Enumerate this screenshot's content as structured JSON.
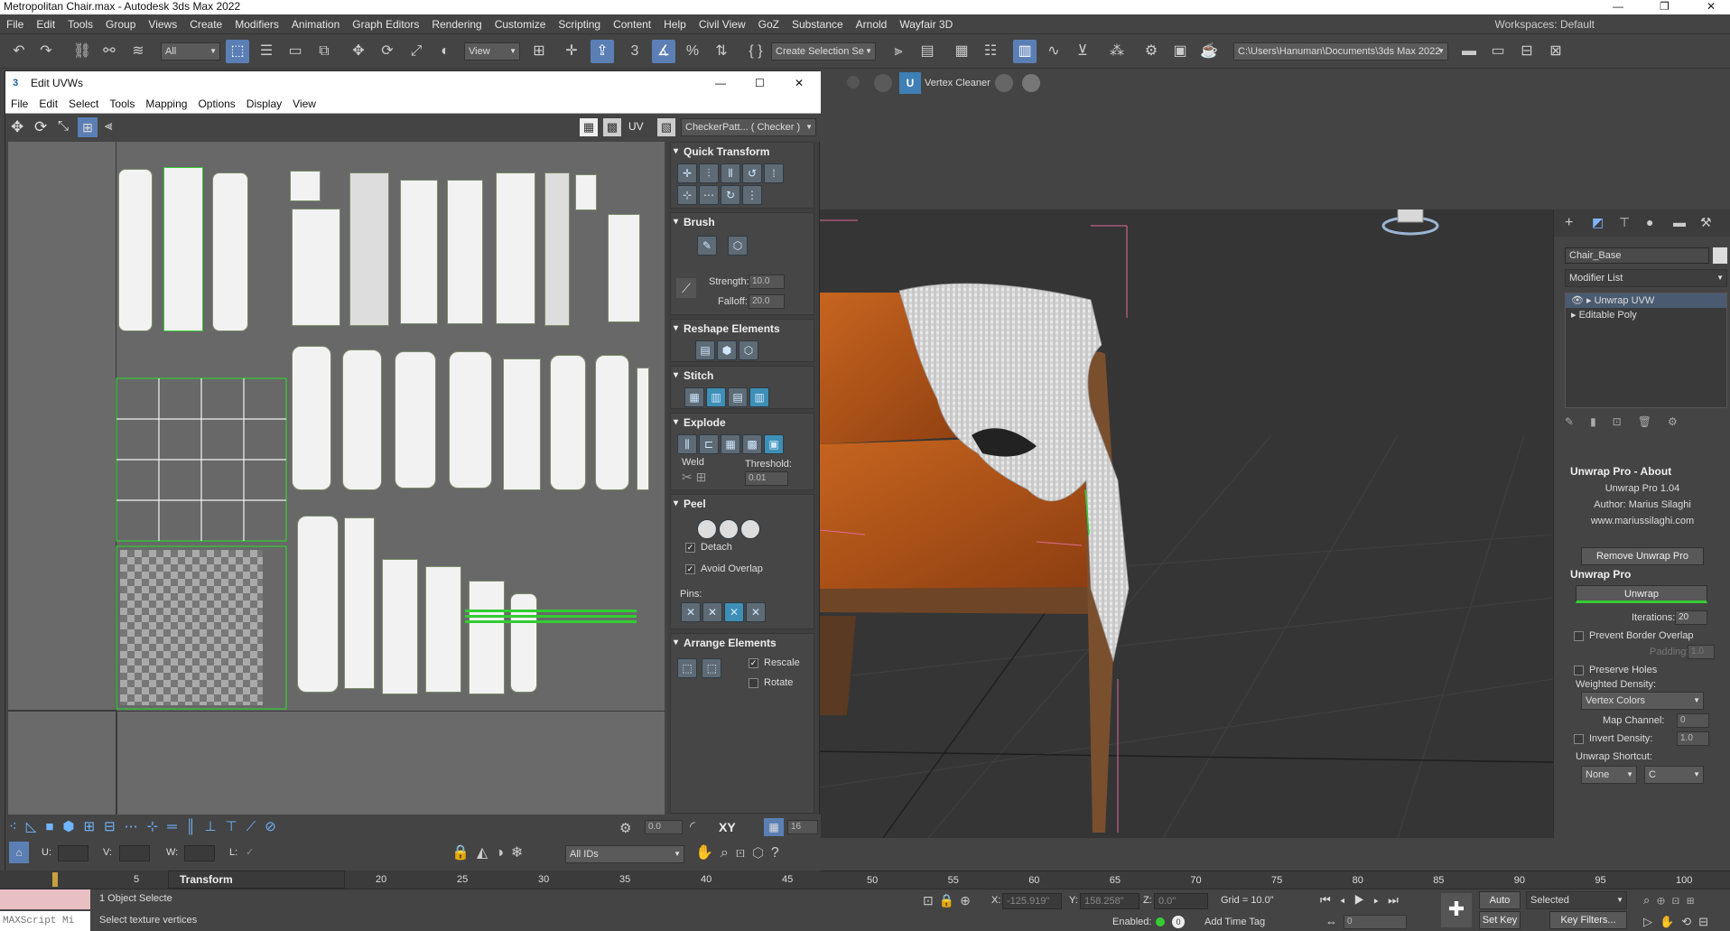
{
  "app": {
    "title": "Metropolitan Chair.max - Autodesk 3ds Max 2022",
    "minimize": "—",
    "maximize": "❐",
    "close": "✕"
  },
  "menu": [
    "File",
    "Edit",
    "Tools",
    "Group",
    "Views",
    "Create",
    "Modifiers",
    "Animation",
    "Graph Editors",
    "Rendering",
    "Customize",
    "Scripting",
    "Content",
    "Help",
    "Civil View",
    "GoZ",
    "Substance",
    "Arnold",
    "Wayfair 3D"
  ],
  "workspaces": "Workspaces:  Default",
  "toolbar": {
    "filter": "All",
    "view": "View",
    "snap3": "3",
    "selection_set": "Create Selection Se",
    "path": "C:\\Users\\Hanuman\\Documents\\3ds Max 2022",
    "vertex_cleaner": "Vertex Cleaner"
  },
  "uvw": {
    "title": "Edit UVWs",
    "menu": [
      "File",
      "Edit",
      "Select",
      "Tools",
      "Mapping",
      "Options",
      "Display",
      "View"
    ],
    "uv_label": "UV",
    "texture": "CheckerPatt... ( Checker )",
    "quick_transform": "Quick Transform",
    "brush": "Brush",
    "strength_label": "Strength:",
    "strength": "10.0",
    "falloff_label": "Falloff:",
    "falloff": "20.0",
    "reshape": "Reshape Elements",
    "stitch": "Stitch",
    "explode": "Explode",
    "weld": "Weld",
    "threshold_label": "Threshold:",
    "threshold": "0.01",
    "peel": "Peel",
    "detach": "Detach",
    "avoid_overlap": "Avoid Overlap",
    "pins": "Pins:",
    "arrange": "Arrange Elements",
    "rescale": "Rescale",
    "rotate": "Rotate",
    "angle": "0.0",
    "xy": "XY",
    "grid_count": "16",
    "u_label": "U:",
    "v_label": "V:",
    "w_label": "W:",
    "l_label": "L:",
    "ids": "All IDs"
  },
  "command_panel": {
    "object_name": "Chair_Base",
    "modifier_list": "Modifier List",
    "stack": [
      "Unwrap UVW",
      "Editable Poly"
    ],
    "about_title": "Unwrap Pro - About",
    "about_version": "Unwrap Pro 1.04",
    "about_author": "Author: Marius Silaghi",
    "about_site": "www.mariussilaghi.com",
    "remove_btn": "Remove Unwrap Pro",
    "unwrap_title": "Unwrap Pro",
    "unwrap_btn": "Unwrap",
    "iterations_label": "Iterations:",
    "iterations": "20",
    "prevent_border": "Prevent Border Overlap",
    "padding_label": "Padding:",
    "padding": "1.0",
    "preserve_holes": "Preserve Holes",
    "weighted_density": "Weighted Density:",
    "density_source": "Vertex Colors",
    "map_channel_label": "Map Channel:",
    "map_channel": "0",
    "invert_density_label": "Invert Density:",
    "invert_density": "1.0",
    "shortcut_label": "Unwrap Shortcut:",
    "shortcut_mod": "None",
    "shortcut_key": "C"
  },
  "timeline": {
    "ticks": [
      "5",
      "20",
      "25",
      "30",
      "35",
      "40",
      "45",
      "50",
      "55",
      "60",
      "65",
      "70",
      "75",
      "80",
      "85",
      "90",
      "95",
      "100"
    ]
  },
  "status": {
    "maxscript": "MAXScript Mi",
    "selected": "1 Object Selecte",
    "prompt": "Select texture vertices",
    "transform": "Transform",
    "x_label": "X:",
    "x": "-125.919\"",
    "y_label": "Y:",
    "y": "158.258\"",
    "z_label": "Z:",
    "z": "0.0\"",
    "grid": "Grid = 10.0\"",
    "enabled": "Enabled:",
    "add_time_tag": "Add Time Tag",
    "auto_key": "Auto Key",
    "set_key": "Set Key",
    "selected_drop": "Selected",
    "key_filters": "Key Filters...",
    "frame": "0"
  },
  "colors": {
    "accent": "#5b7fb5",
    "uv_green": "#33cc33",
    "leather": "#b85a1e",
    "wood": "#7a4f2e"
  }
}
